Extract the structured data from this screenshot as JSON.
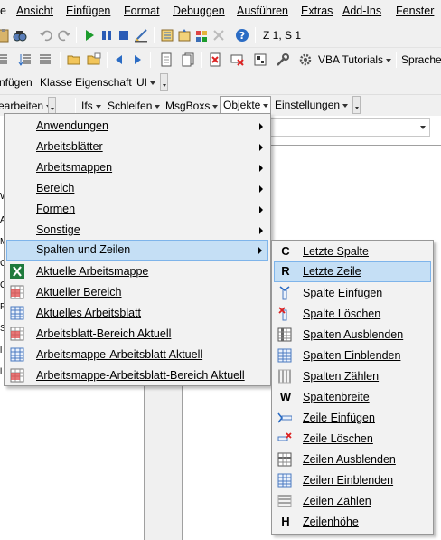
{
  "menubar": [
    "e",
    "Ansicht",
    "Einfügen",
    "Format",
    "Debuggen",
    "Ausführen",
    "Extras",
    "Add-Ins",
    "Fenster"
  ],
  "toolbar1": {
    "position": "Z 1, S 1"
  },
  "toolbar2": {
    "vba_tutorials": "VBA Tutorials",
    "sprachen": "Sprachen"
  },
  "toolbar3": {
    "items": [
      "nfügen",
      "Klasse",
      "Eigenschaft",
      "UI"
    ]
  },
  "toolbar4": {
    "items": [
      "earbeiten",
      "Ifs",
      "Schleifen",
      "MsgBoxs",
      "Objekte",
      "Einstellungen"
    ]
  },
  "menu_main": {
    "items": [
      {
        "label": "Anwendungen",
        "submenu": true
      },
      {
        "label": "Arbeitsblätter",
        "submenu": true
      },
      {
        "label": "Arbeitsmappen",
        "submenu": true
      },
      {
        "label": "Bereich",
        "submenu": true
      },
      {
        "label": "Formen",
        "submenu": true
      },
      {
        "label": "Sonstige",
        "submenu": true
      },
      {
        "label": "Spalten und Zeilen",
        "submenu": true,
        "highlighted": true
      },
      {
        "label": "Aktuelle Arbeitsmappe",
        "icon": "excel-icon"
      },
      {
        "label": "Aktueller Bereich",
        "icon": "range-icon"
      },
      {
        "label": "Aktuelles Arbeitsblatt",
        "icon": "sheet-icon"
      },
      {
        "label": "Arbeitsblatt-Bereich Aktuell",
        "icon": "range-icon"
      },
      {
        "label": "Arbeitsmappe-Arbeitsblatt Aktuell",
        "icon": "sheet-icon"
      },
      {
        "label": "Arbeitsmappe-Arbeitsblatt-Bereich Aktuell",
        "icon": "range-icon"
      }
    ]
  },
  "menu_sub": {
    "items": [
      {
        "label": "Letzte Spalte",
        "glyph": "C"
      },
      {
        "label": "Letzte Zeile",
        "glyph": "R",
        "highlighted": true
      },
      {
        "label": "Spalte Einfügen",
        "icon": "insert-column-icon"
      },
      {
        "label": "Spalte Löschen",
        "icon": "delete-column-icon"
      },
      {
        "label": "Spalten Ausblenden",
        "icon": "hide-columns-icon"
      },
      {
        "label": "Spalten Einblenden",
        "icon": "show-columns-icon"
      },
      {
        "label": "Spalten Zählen",
        "icon": "count-columns-icon"
      },
      {
        "label": "Spaltenbreite",
        "glyph": "W"
      },
      {
        "label": "Zeile Einfügen",
        "icon": "insert-row-icon"
      },
      {
        "label": "Zeile Löschen",
        "icon": "delete-row-icon"
      },
      {
        "label": "Zeilen Ausblenden",
        "icon": "hide-rows-icon"
      },
      {
        "label": "Zeilen Einblenden",
        "icon": "show-rows-icon"
      },
      {
        "label": "Zeilen Zählen",
        "icon": "count-rows-icon"
      },
      {
        "label": "Zeilenhöhe",
        "glyph": "H"
      }
    ]
  },
  "left_fragments": [
    "W",
    "A",
    "M",
    "Ci",
    "Ci",
    "Fi",
    "Sh",
    "l",
    "l"
  ],
  "colors": {
    "menu_bg": "#f2f2f2",
    "highlight_bg": "#c5dff5",
    "highlight_border": "#7eb4ea"
  }
}
